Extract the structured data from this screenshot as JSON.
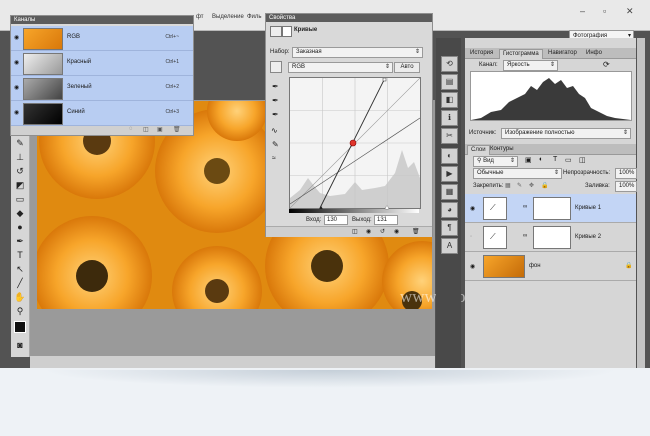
{
  "menu": {
    "items": [
      "фт",
      "Выделение",
      "Филь"
    ],
    "workspace": "Фотография"
  },
  "channels": {
    "title": "Каналы",
    "items": [
      {
        "name": "RGB",
        "shortcut": "Ctrl+~"
      },
      {
        "name": "Красный",
        "shortcut": "Ctrl+1"
      },
      {
        "name": "Зеленый",
        "shortcut": "Ctrl+2"
      },
      {
        "name": "Синий",
        "shortcut": "Ctrl+3"
      }
    ]
  },
  "properties": {
    "title": "Свойства",
    "adjustment": "Кривые",
    "preset_label": "Набор:",
    "preset_value": "Заказная",
    "channel_value": "RGB",
    "auto_button": "Авто",
    "input_label": "Вход:",
    "input_value": "130",
    "output_label": "Выход:",
    "output_value": "131"
  },
  "histogram_panel": {
    "tabs": [
      "История",
      "Гистограмма",
      "Навигатор",
      "Инфо"
    ],
    "active_tab": "Гистограмма",
    "channel_label": "Канал:",
    "channel_value": "Яркость",
    "source_label": "Источник:",
    "source_value": "Изображение полностью"
  },
  "layers_panel": {
    "tabs": [
      "Слои",
      "Контуры"
    ],
    "active_tab": "Слои",
    "filter_value": "Вид",
    "blend_mode": "Обычные",
    "opacity_label": "Непрозрачность:",
    "opacity_value": "100%",
    "lock_label": "Закрепить:",
    "fill_label": "Заливка:",
    "fill_value": "100%",
    "layers": [
      {
        "name": "Кривые 1",
        "selected": true,
        "visible": true
      },
      {
        "name": "Кривые 2",
        "selected": false,
        "visible": false
      },
      {
        "name": "фон",
        "selected": false,
        "visible": true
      }
    ]
  },
  "watermark": "www.photoshopsunduchok.ru",
  "colors": {
    "channel_highlight": "#b8cdf2",
    "layer_highlight": "#c3d5f5",
    "panel_bg": "#d6d6d6"
  }
}
